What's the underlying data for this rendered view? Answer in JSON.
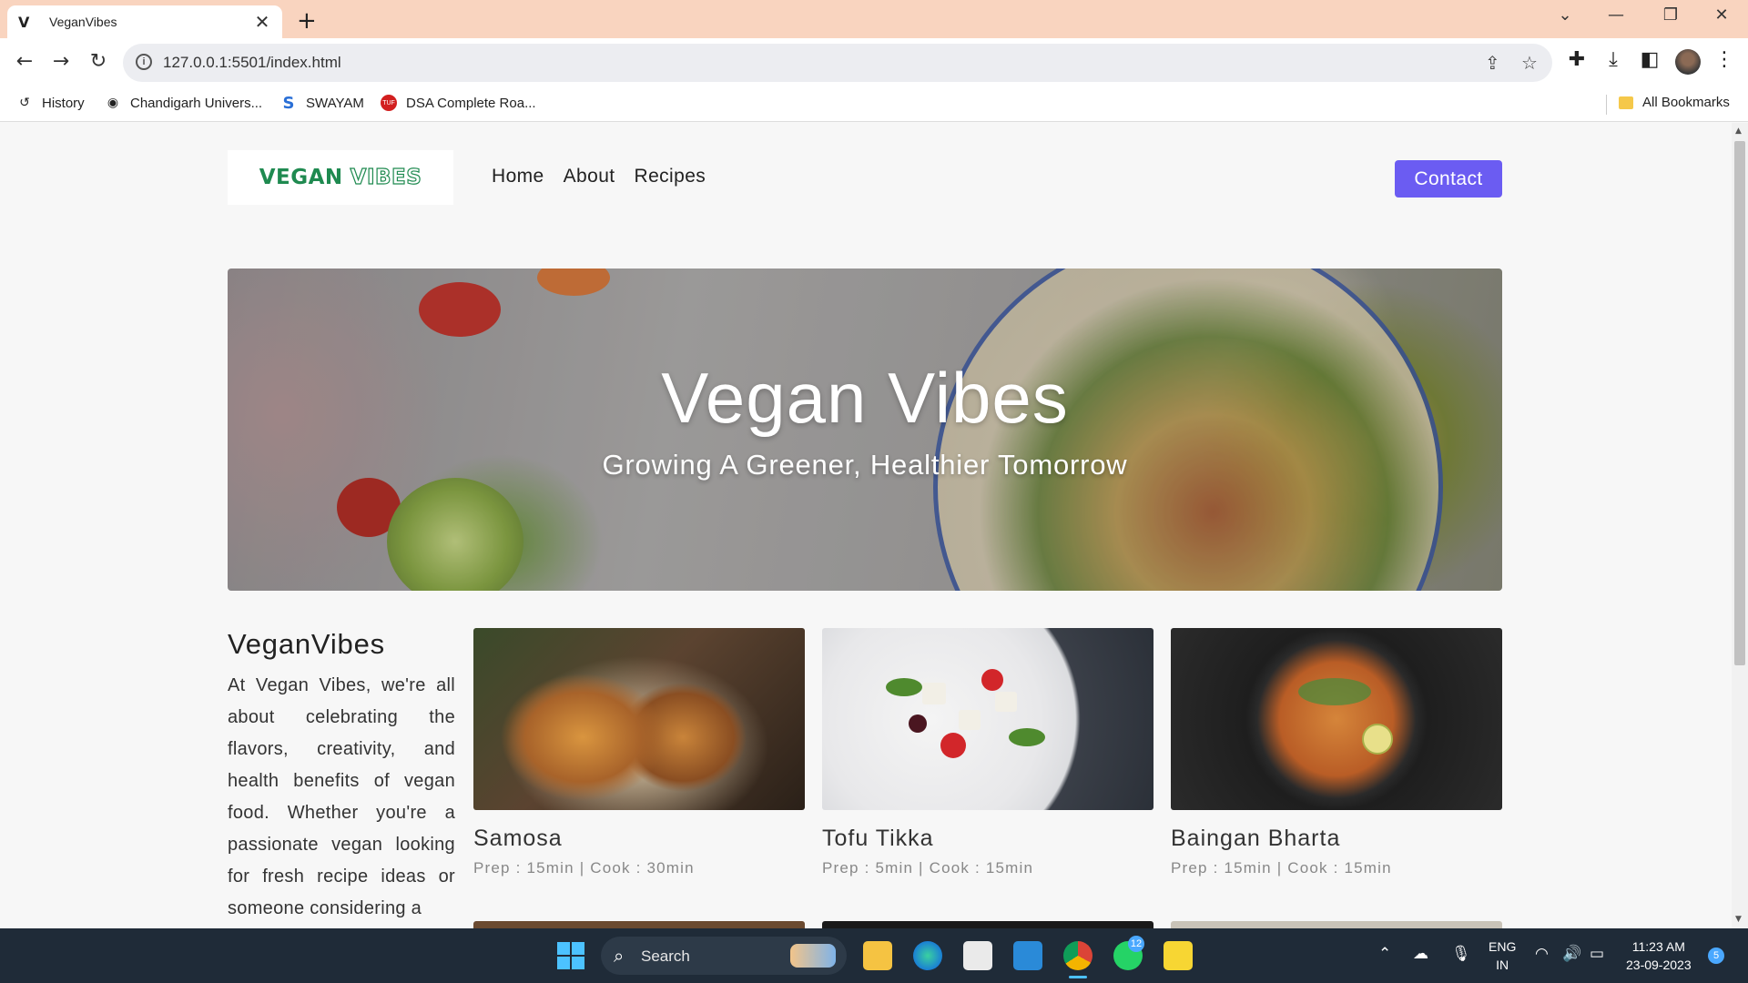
{
  "browser": {
    "tab": {
      "favicon": "V",
      "title": "VeganVibes",
      "close": "✕"
    },
    "new_tab": "+",
    "window_controls": {
      "dropdown": "⌄",
      "minimize": "—",
      "restore": "❐",
      "close": "✕"
    },
    "nav": {
      "back": "←",
      "forward": "→",
      "reload": "↻"
    },
    "url": "127.0.0.1:5501/index.html",
    "bookmarks": [
      {
        "label": "History",
        "icon": "history-icon"
      },
      {
        "label": "Chandigarh Univers...",
        "icon": "globe-icon"
      },
      {
        "label": "SWAYAM",
        "icon": "swayam-icon"
      },
      {
        "label": "DSA Complete Roa...",
        "icon": "tuf-icon"
      }
    ],
    "all_bookmarks": "All Bookmarks"
  },
  "site": {
    "logo": {
      "part1": "VEGAN",
      "part2": "VIBES"
    },
    "nav": [
      "Home",
      "About",
      "Recipes"
    ],
    "contact": "Contact",
    "hero": {
      "title": "Vegan Vibes",
      "subtitle": "Growing A Greener, Healthier Tomorrow"
    },
    "about": {
      "heading": "VeganVibes",
      "text": "At Vegan Vibes, we're all about celebrating the flavors, creativity, and health benefits of vegan food. Whether you're a passionate vegan looking for fresh recipe ideas or someone considering a"
    },
    "recipes": [
      {
        "title": "Samosa",
        "meta": "Prep : 15min | Cook : 30min"
      },
      {
        "title": "Tofu Tikka",
        "meta": "Prep : 5min | Cook : 15min"
      },
      {
        "title": "Baingan Bharta",
        "meta": "Prep : 15min | Cook : 15min"
      }
    ]
  },
  "taskbar": {
    "search": "Search",
    "whatsapp_badge": "12",
    "language": {
      "line1": "ENG",
      "line2": "IN"
    },
    "clock": {
      "time": "11:23 AM",
      "date": "23-09-2023"
    },
    "notification_count": "5"
  },
  "colors": {
    "accent": "#6b5cf2",
    "logo_green": "#1f8a50",
    "titlebar": "#f9d4bf",
    "taskbar": "#1f2b38"
  }
}
